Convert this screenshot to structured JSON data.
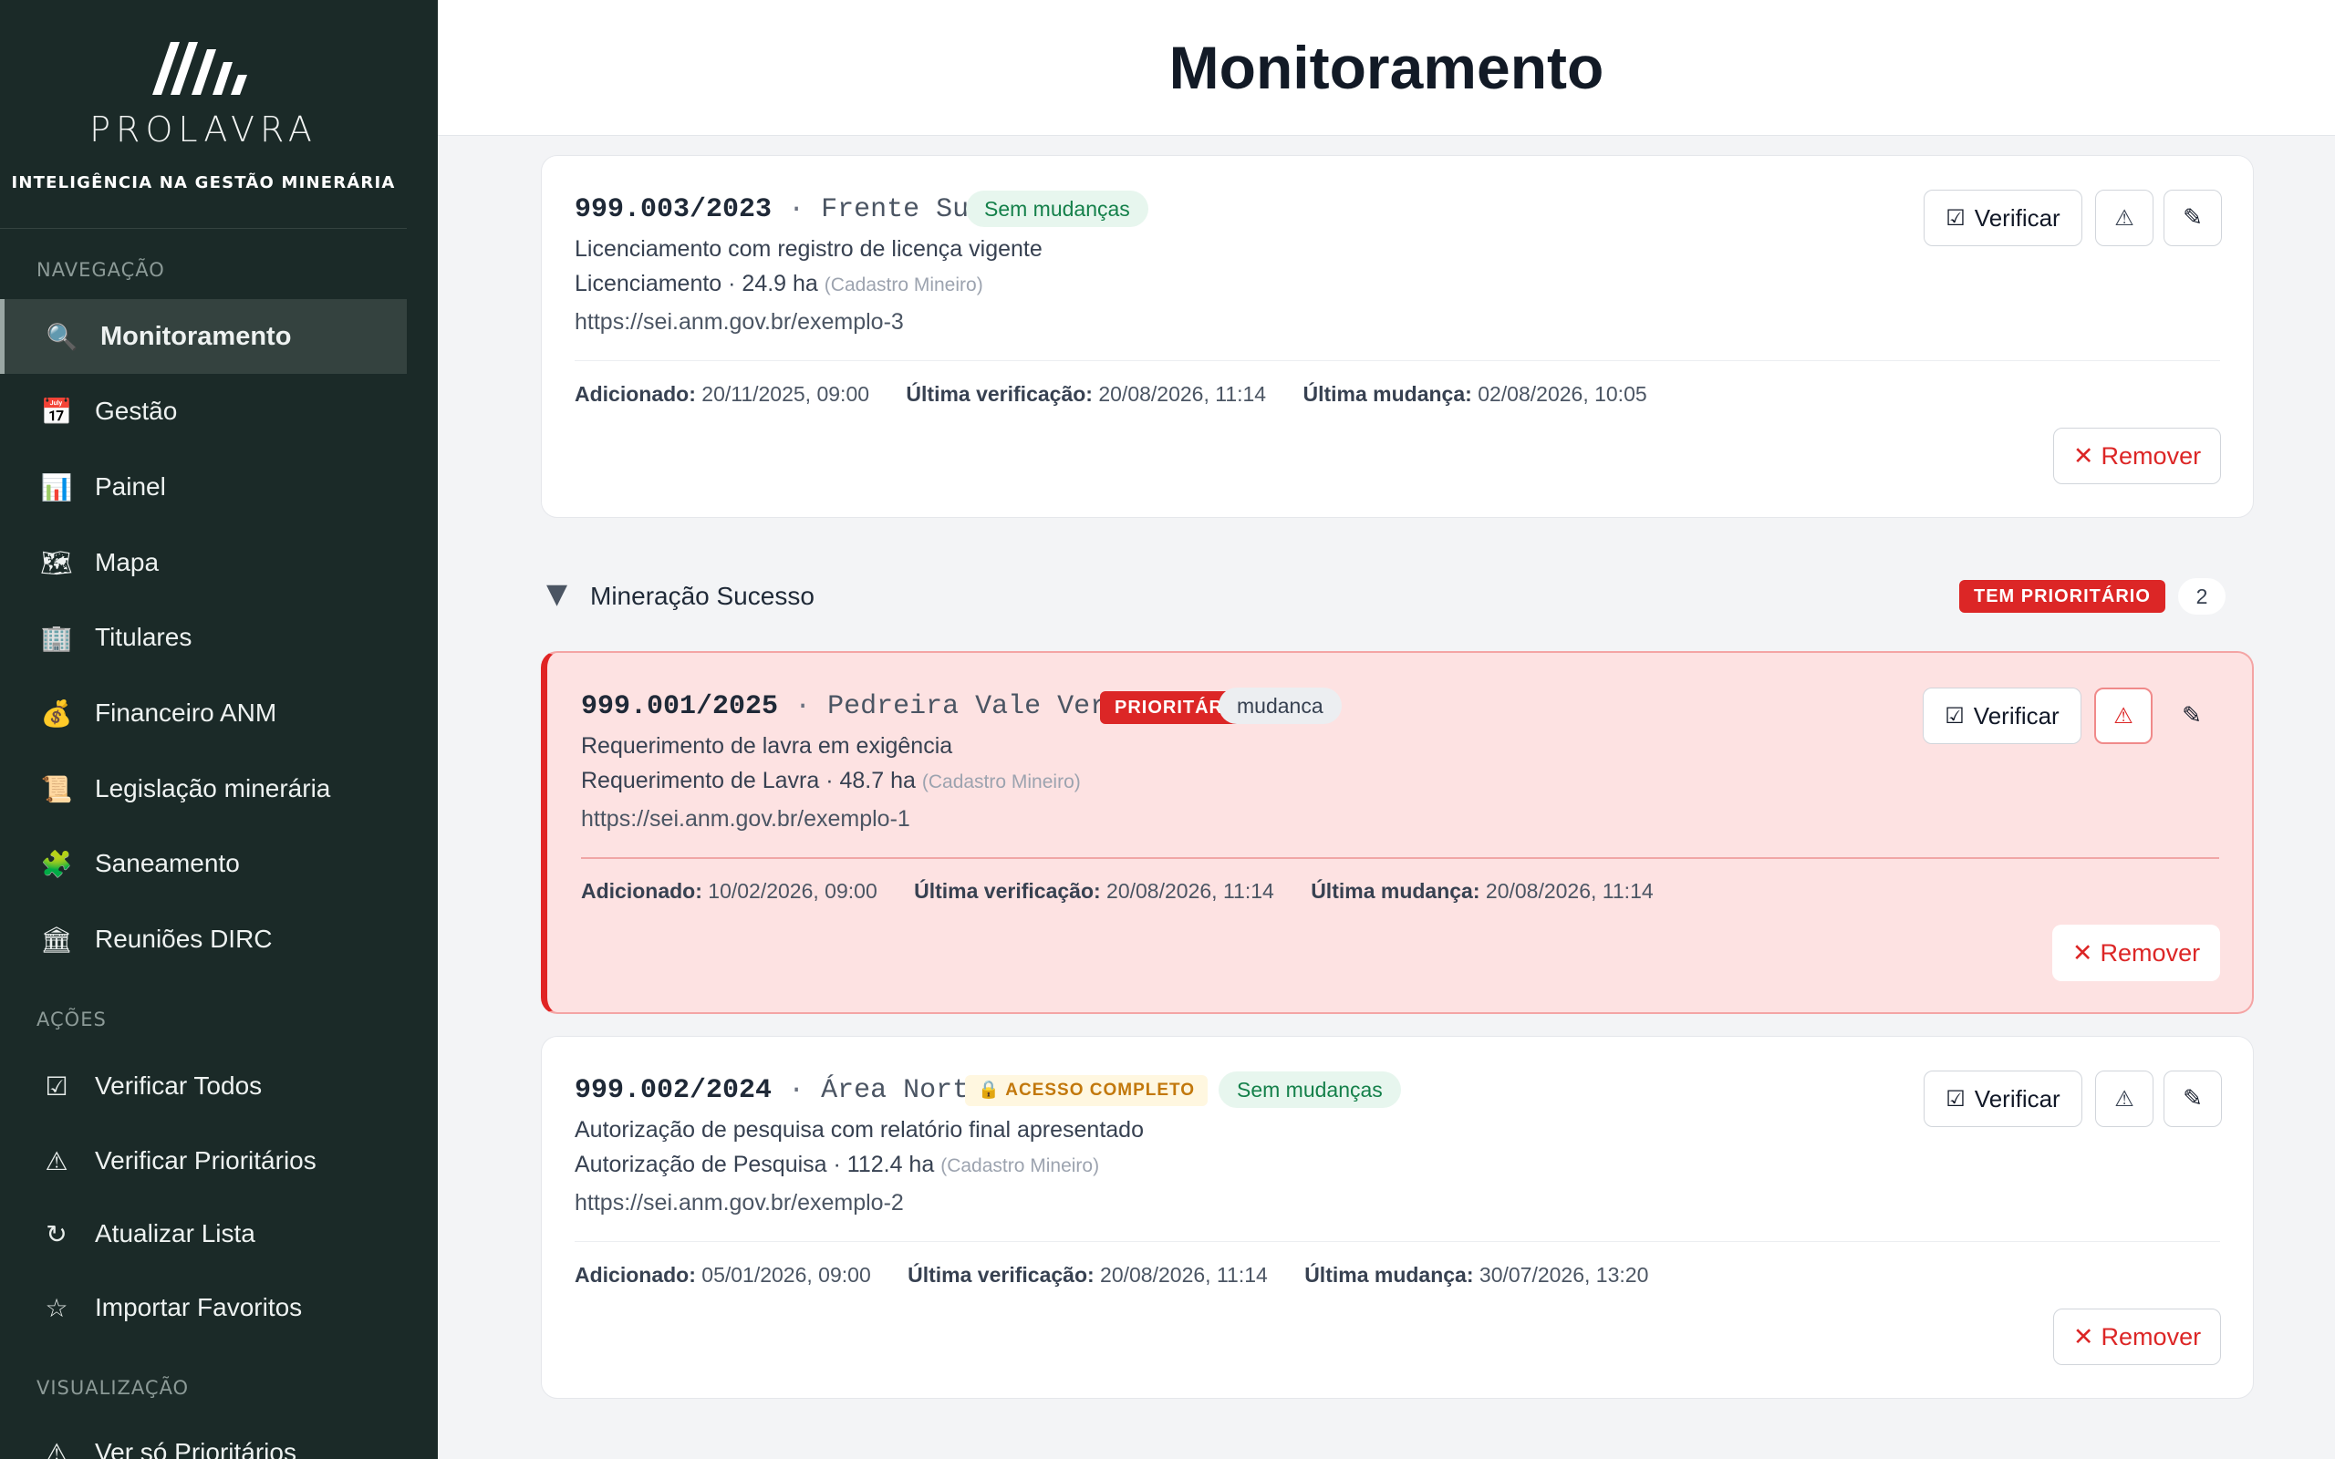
{
  "brand": {
    "name": "PROLAVRA",
    "tagline": "INTELIGÊNCIA NA GESTÃO MINERÁRIA"
  },
  "sidebar": {
    "nav_label": "NAVEGAÇÃO",
    "nav_items": [
      {
        "label": "Monitoramento",
        "icon": "🔍"
      },
      {
        "label": "Gestão",
        "icon": "📅"
      },
      {
        "label": "Painel",
        "icon": "📊"
      },
      {
        "label": "Mapa",
        "icon": "🗺"
      },
      {
        "label": "Titulares",
        "icon": "🏢"
      },
      {
        "label": "Financeiro ANM",
        "icon": "💰"
      },
      {
        "label": "Legislação minerária",
        "icon": "📜"
      },
      {
        "label": "Saneamento",
        "icon": "🧩"
      },
      {
        "label": "Reuniões DIRC",
        "icon": "🏛"
      }
    ],
    "actions_label": "AÇÕES",
    "action_items": [
      {
        "label": "Verificar Todos",
        "icon": "☑"
      },
      {
        "label": "Verificar Prioritários",
        "icon": "⚠"
      },
      {
        "label": "Atualizar Lista",
        "icon": "↻"
      },
      {
        "label": "Importar Favoritos",
        "icon": "☆"
      }
    ],
    "view_label": "VISUALIZAÇÃO",
    "view_items": [
      {
        "label": "Ver só Prioritários",
        "icon": "⚠"
      }
    ]
  },
  "header": {
    "title": "Monitoramento"
  },
  "labels": {
    "added": "Adicionado:",
    "last_check": "Última verificação:",
    "last_change": "Última mudança:",
    "verify": "Verificar",
    "remove": "Remover",
    "source": "(Cadastro Mineiro)",
    "verify_icon": "☑",
    "warn_icon": "⚠",
    "edit_icon": "✎",
    "remove_icon": "✕"
  },
  "group": {
    "name": "Mineração Sucesso",
    "badge": "TEM PRIORITÁRIO",
    "count": "2",
    "toggle_icon": "▼"
  },
  "cards": [
    {
      "number": "999.003/2023",
      "separator": "·",
      "name": "Frente Sul",
      "status": "Sem mudanças",
      "description": "Licenciamento com registro de licença vigente",
      "regime": "Licenciamento · 24.9 ha",
      "url": "https://sei.anm.gov.br/exemplo-3",
      "added": "20/11/2025, 09:00",
      "last_check": "20/08/2026, 11:14",
      "last_change": "02/08/2026, 10:05"
    },
    {
      "number": "999.001/2025",
      "separator": "·",
      "name": "Pedreira Vale Verde",
      "priority_badge": "PRIORITÁRIO",
      "status": "mudanca",
      "description": "Requerimento de lavra em exigência",
      "regime": "Requerimento de Lavra · 48.7 ha",
      "url": "https://sei.anm.gov.br/exemplo-1",
      "added": "10/02/2026, 09:00",
      "last_check": "20/08/2026, 11:14",
      "last_change": "20/08/2026, 11:14"
    },
    {
      "number": "999.002/2024",
      "separator": "·",
      "name": "Área Norte",
      "access_badge": "🔒 ACESSO COMPLETO",
      "status": "Sem mudanças",
      "description": "Autorização de pesquisa com relatório final apresentado",
      "regime": "Autorização de Pesquisa · 112.4 ha",
      "url": "https://sei.anm.gov.br/exemplo-2",
      "added": "05/01/2026, 09:00",
      "last_check": "20/08/2026, 11:14",
      "last_change": "30/07/2026, 13:20"
    }
  ]
}
